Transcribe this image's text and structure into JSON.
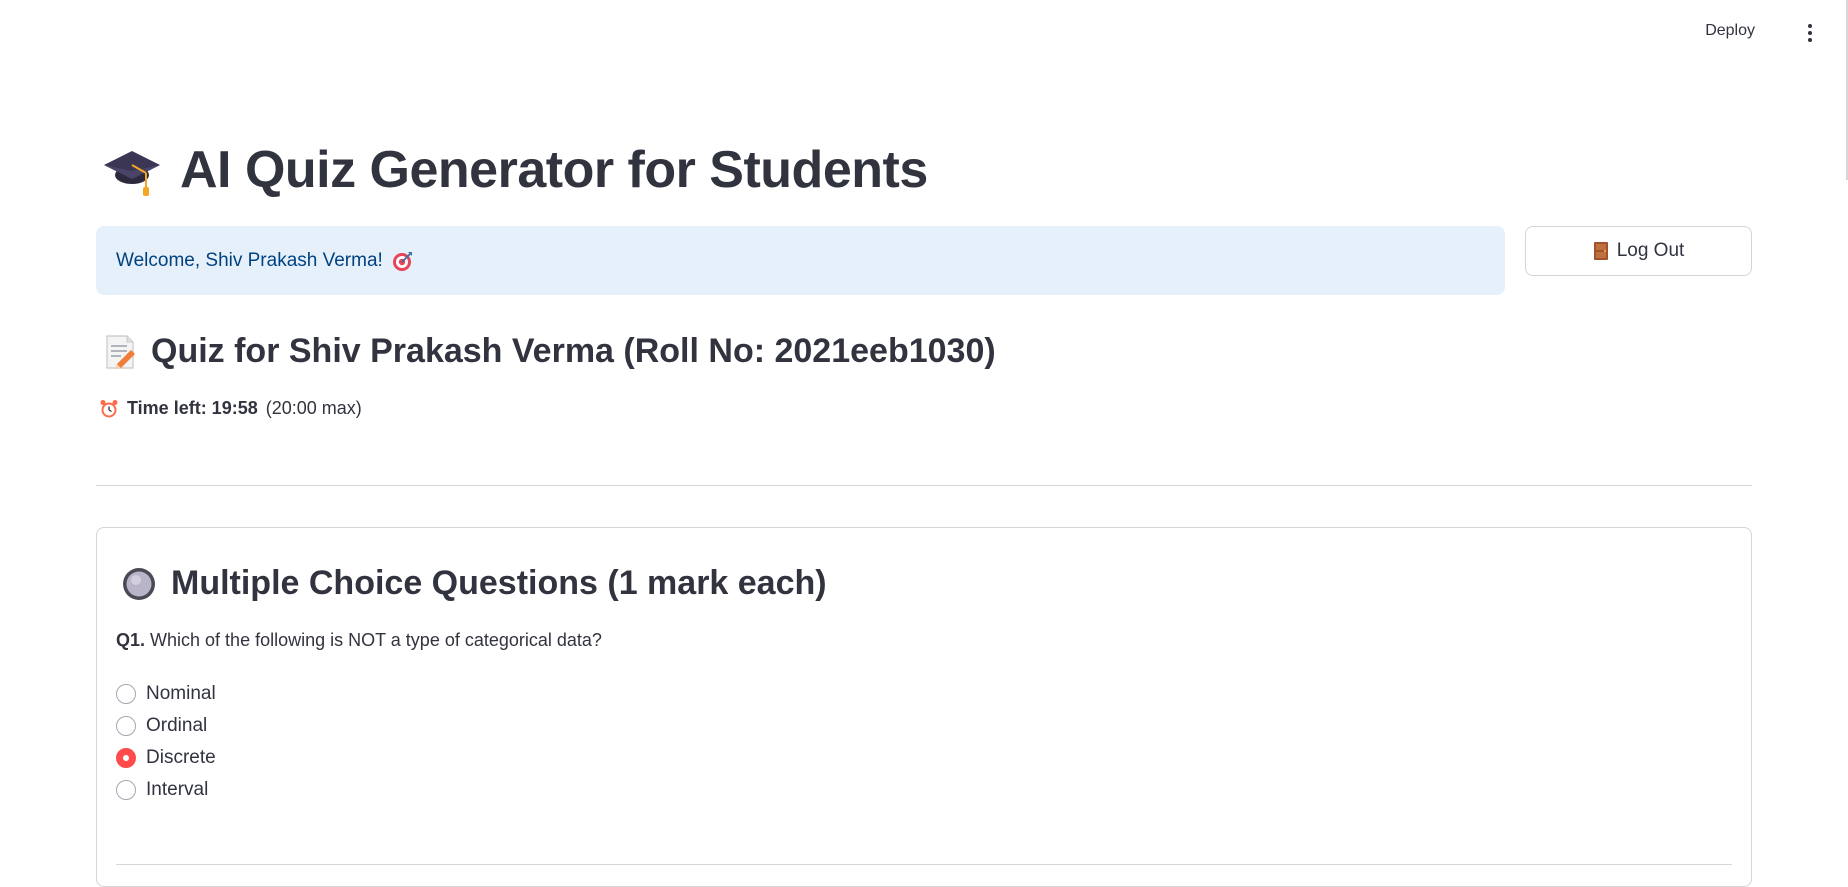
{
  "header": {
    "deploy_label": "Deploy",
    "menu_icon": "kebab-menu-icon"
  },
  "page": {
    "title": "AI Quiz Generator for Students",
    "title_icon": "graduation-cap-icon"
  },
  "welcome": {
    "text": "Welcome, Shiv Prakash Verma!",
    "icon": "target-icon",
    "background": "#e6f0fb",
    "text_color": "#004280"
  },
  "logout": {
    "label": "Log Out",
    "icon": "door-icon"
  },
  "quiz": {
    "heading": "Quiz for Shiv Prakash Verma (Roll No: 2021eeb1030)",
    "heading_icon": "memo-icon",
    "timer_icon": "alarm-clock-icon",
    "timer_label": "Time left: 19:58",
    "timer_suffix": "(20:00 max)"
  },
  "mcq": {
    "section_title": "Multiple Choice Questions (1 mark each)",
    "section_icon": "radio-button-icon",
    "questions": [
      {
        "number": "Q1.",
        "text": "Which of the following is NOT a type of categorical data?",
        "options": [
          "Nominal",
          "Ordinal",
          "Discrete",
          "Interval"
        ],
        "selected": "Discrete"
      }
    ]
  },
  "colors": {
    "accent": "#ff4b4b",
    "text": "#31333f",
    "border": "#d6d6d9"
  }
}
